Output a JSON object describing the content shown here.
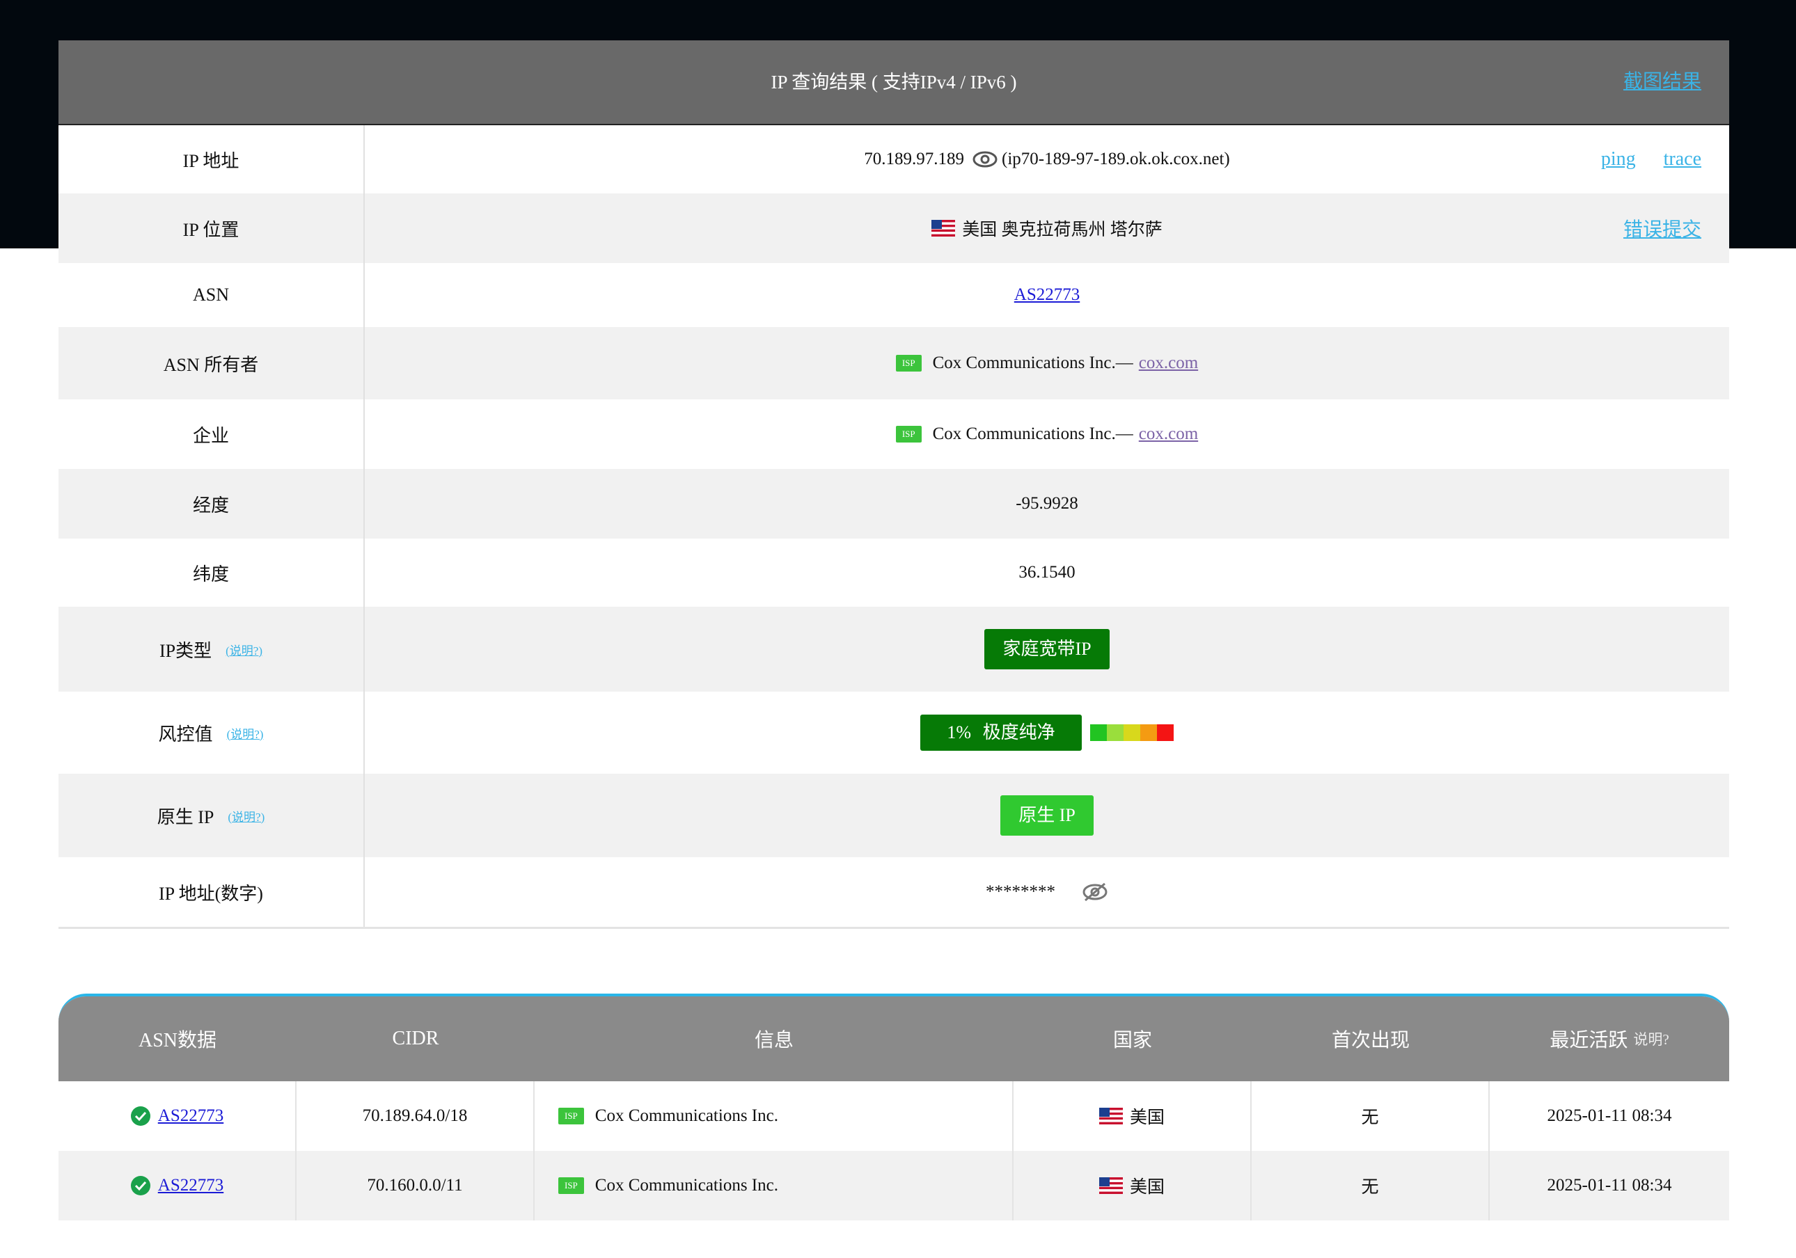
{
  "header": {
    "title": "IP 查询结果 ( 支持IPv4 / IPv6 )",
    "screenshot_label": "截图结果"
  },
  "rows": {
    "ip": {
      "label": "IP 地址",
      "value": "70.189.97.189",
      "hostname": "(ip70-189-97-189.ok.ok.cox.net)",
      "ping": "ping",
      "trace": "trace"
    },
    "location": {
      "label": "IP 位置",
      "value": "美国 奥克拉荷馬州 塔尔萨",
      "report": "错误提交"
    },
    "asn": {
      "label": "ASN",
      "value": "AS22773"
    },
    "asn_owner": {
      "label": "ASN 所有者",
      "badge": "ISP",
      "name": "Cox Communications Inc.—",
      "domain": "cox.com"
    },
    "company": {
      "label": "企业",
      "badge": "ISP",
      "name": "Cox Communications Inc.—",
      "domain": "cox.com"
    },
    "longitude": {
      "label": "经度",
      "value": "-95.9928"
    },
    "latitude": {
      "label": "纬度",
      "value": "36.1540"
    },
    "ip_type": {
      "label": "IP类型",
      "explain": "(说明?)",
      "value": "家庭宽带IP"
    },
    "risk": {
      "label": "风控值",
      "explain": "(说明?)",
      "value": "1%  极度纯净",
      "scale_colors": [
        "#22c422",
        "#9ade3c",
        "#d8d81c",
        "#f49b12",
        "#f41414"
      ]
    },
    "native": {
      "label": "原生 IP",
      "explain": "(说明?)",
      "value": "原生 IP"
    },
    "ip_numeric": {
      "label": "IP 地址(数字)",
      "value": "********"
    }
  },
  "asn_table": {
    "headers": {
      "asn": "ASN数据",
      "cidr": "CIDR",
      "info": "信息",
      "country": "国家",
      "first_seen": "首次出现",
      "last_active": "最近活跃",
      "last_active_hint": "说明?"
    },
    "rows": [
      {
        "asn": "AS22773",
        "cidr": "70.189.64.0/18",
        "badge": "ISP",
        "info": "Cox Communications Inc.",
        "country": "美国",
        "first_seen": "无",
        "last_active": "2025-01-11 08:34"
      },
      {
        "asn": "AS22773",
        "cidr": "70.160.0.0/11",
        "badge": "ISP",
        "info": "Cox Communications Inc.",
        "country": "美国",
        "first_seen": "无",
        "last_active": "2025-01-11 08:34"
      }
    ]
  },
  "colors": {
    "accent": "#3ab3e6",
    "header_bg": "#696969",
    "green_dark": "#067a06",
    "green_light": "#30c930"
  }
}
